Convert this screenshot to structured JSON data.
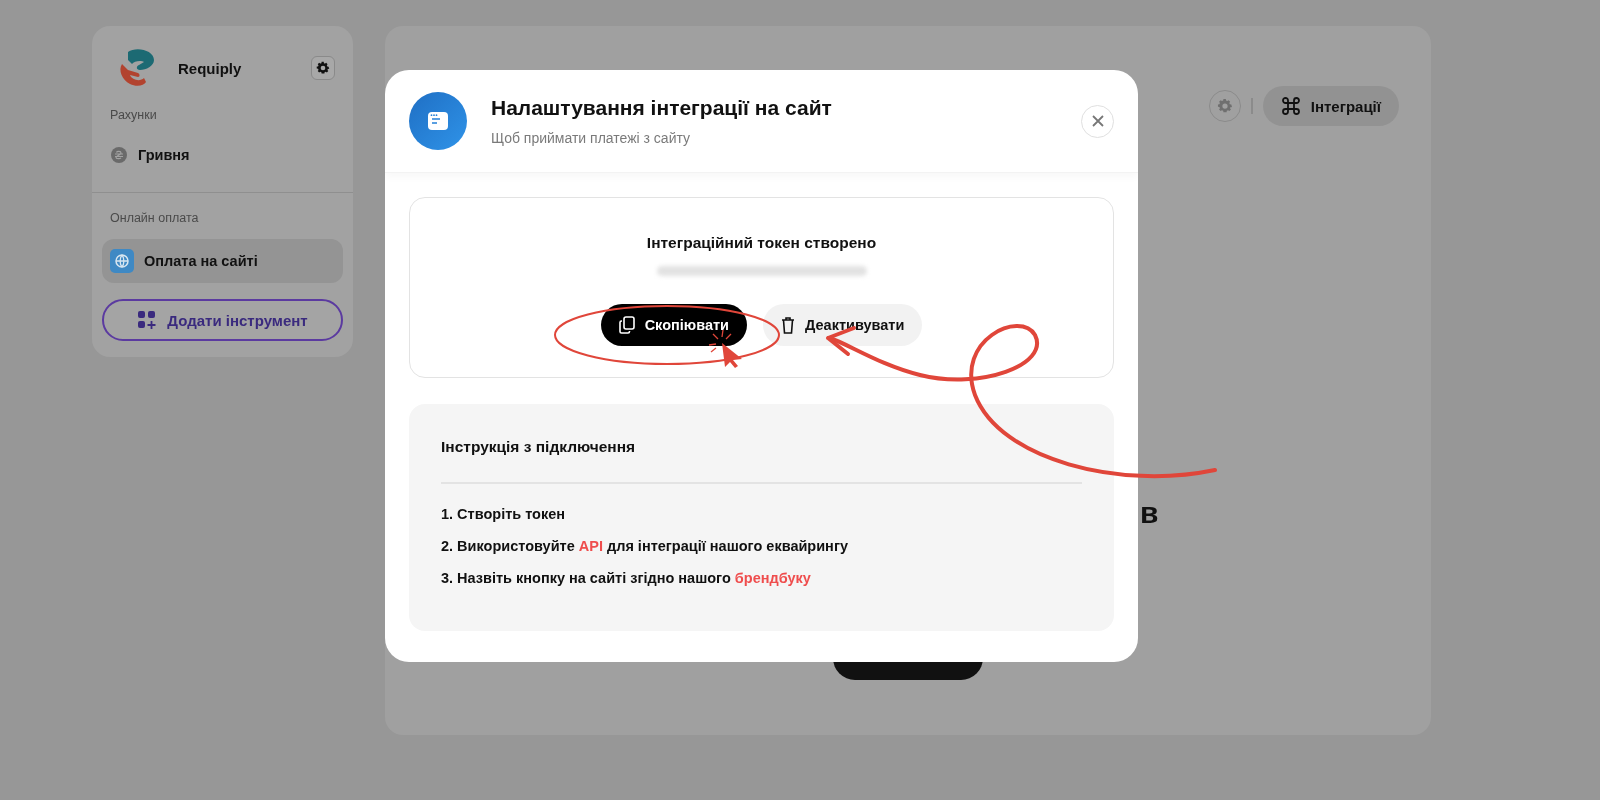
{
  "sidebar": {
    "brand": "Requiply",
    "sections": [
      {
        "title": "Рахунки",
        "items": [
          {
            "label": "Гривня",
            "kind": "currency",
            "selected": false
          }
        ]
      },
      {
        "title": "Онлайн оплата",
        "items": [
          {
            "label": "Оплата на сайті",
            "kind": "globe",
            "selected": true
          }
        ]
      }
    ],
    "add_button": "Додати інструмент"
  },
  "main": {
    "integrations_button": "Інтеграції",
    "heading_fragment": "в"
  },
  "modal": {
    "title": "Налаштування інтеграції на сайт",
    "subtitle": "Щоб приймати платежі з сайту",
    "token_title": "Інтеграційний токен створено",
    "copy_button": "Скопіювати",
    "deactivate_button": "Деактивувати",
    "instructions": {
      "title": "Інструкція з підключення",
      "steps": [
        [
          {
            "text": "1. Створіть токен",
            "kind": "text"
          }
        ],
        [
          {
            "text": "2. Використовуйте ",
            "kind": "text"
          },
          {
            "text": "API",
            "kind": "link"
          },
          {
            "text": " для інтеграції нашого еквайрингу",
            "kind": "text"
          }
        ],
        [
          {
            "text": "3. Назвіть кнопку на сайті згідно нашого ",
            "kind": "text"
          },
          {
            "text": "брендбуку",
            "kind": "link"
          }
        ]
      ]
    }
  }
}
